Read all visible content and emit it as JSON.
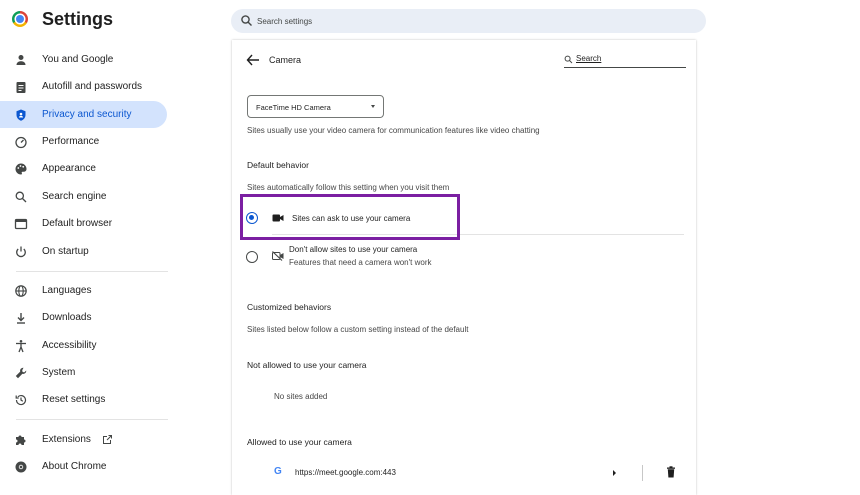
{
  "app": {
    "title": "Settings"
  },
  "search": {
    "placeholder": "Search settings"
  },
  "sidebar": {
    "items": [
      {
        "label": "You and Google",
        "icon": "person-icon"
      },
      {
        "label": "Autofill and passwords",
        "icon": "clipboard-icon"
      },
      {
        "label": "Privacy and security",
        "icon": "shield-icon",
        "active": true
      },
      {
        "label": "Performance",
        "icon": "speedometer-icon"
      },
      {
        "label": "Appearance",
        "icon": "palette-icon"
      },
      {
        "label": "Search engine",
        "icon": "search-icon"
      },
      {
        "label": "Default browser",
        "icon": "browser-window-icon"
      },
      {
        "label": "On startup",
        "icon": "power-icon"
      },
      {
        "label": "Languages",
        "icon": "globe-icon"
      },
      {
        "label": "Downloads",
        "icon": "download-icon"
      },
      {
        "label": "Accessibility",
        "icon": "accessibility-icon"
      },
      {
        "label": "System",
        "icon": "wrench-icon"
      },
      {
        "label": "Reset settings",
        "icon": "history-icon"
      },
      {
        "label": "Extensions",
        "icon": "puzzle-icon"
      },
      {
        "label": "About Chrome",
        "icon": "chrome-icon"
      }
    ]
  },
  "camera_page": {
    "title": "Camera",
    "search_label": "Search",
    "selected_camera": "FaceTime HD Camera",
    "description": "Sites usually use your video camera for communication features like video chatting",
    "default_heading": "Default behavior",
    "default_sub": "Sites automatically follow this setting when you visit them",
    "option_allow": "Sites can ask to use your camera",
    "option_block": "Don't allow sites to use your camera",
    "option_block_sub": "Features that need a camera won't work",
    "custom_heading": "Customized behaviors",
    "custom_sub": "Sites listed below follow a custom setting instead of the default",
    "not_allowed_heading": "Not allowed to use your camera",
    "no_sites": "No sites added",
    "allowed_heading": "Allowed to use your camera",
    "allowed_site": "https://meet.google.com:443",
    "site_icon_letter": "G"
  },
  "colors": {
    "accent": "#0b57d0",
    "active_bg": "#d3e3fd",
    "highlight": "#7b1fa2"
  }
}
